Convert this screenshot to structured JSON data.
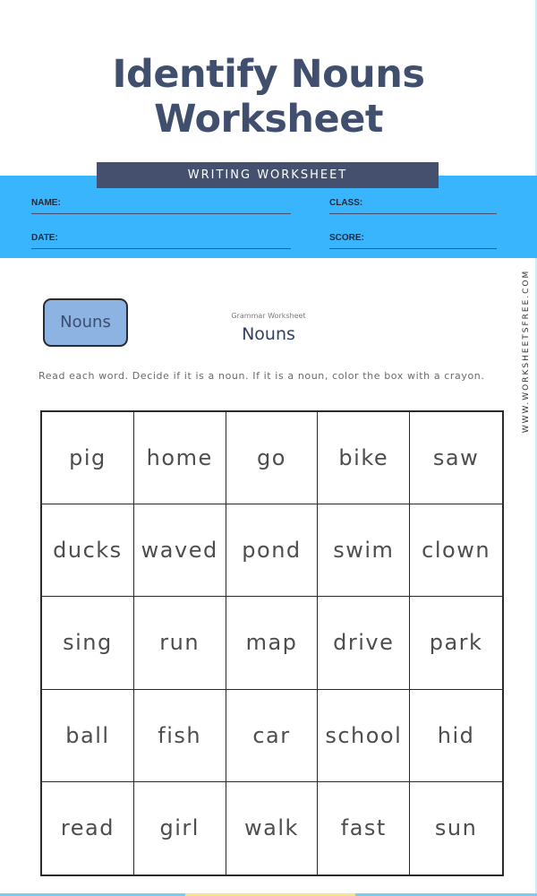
{
  "page_title": "Identify Nouns Worksheet",
  "header": {
    "banner_label": "WRITING WORKSHEET",
    "fields": {
      "name": "NAME:",
      "class": "CLASS:",
      "date": "DATE:",
      "score": "SCORE:"
    }
  },
  "worksheet": {
    "badge_label": "Nouns",
    "subtitle": "Grammar Worksheet",
    "title": "Nouns",
    "instructions": "Read each word.  Decide if it is a noun.  If it is a noun, color the box with a crayon.",
    "watermark": "WWW.WORKSHEETSFREE.COM",
    "words": [
      [
        "pig",
        "home",
        "go",
        "bike",
        "saw"
      ],
      [
        "ducks",
        "waved",
        "pond",
        "swim",
        "clown"
      ],
      [
        "sing",
        "run",
        "map",
        "drive",
        "park"
      ],
      [
        "ball",
        "fish",
        "car",
        "school",
        "hid"
      ],
      [
        "read",
        "girl",
        "walk",
        "fast",
        "sun"
      ]
    ]
  },
  "colors": {
    "title": "#3f4f6d",
    "band": "#39b5fd",
    "banner": "#44506d",
    "badge": "#8db3e2",
    "strip_blue": "#7ccbf0",
    "strip_yellow": "#f7e58e"
  }
}
